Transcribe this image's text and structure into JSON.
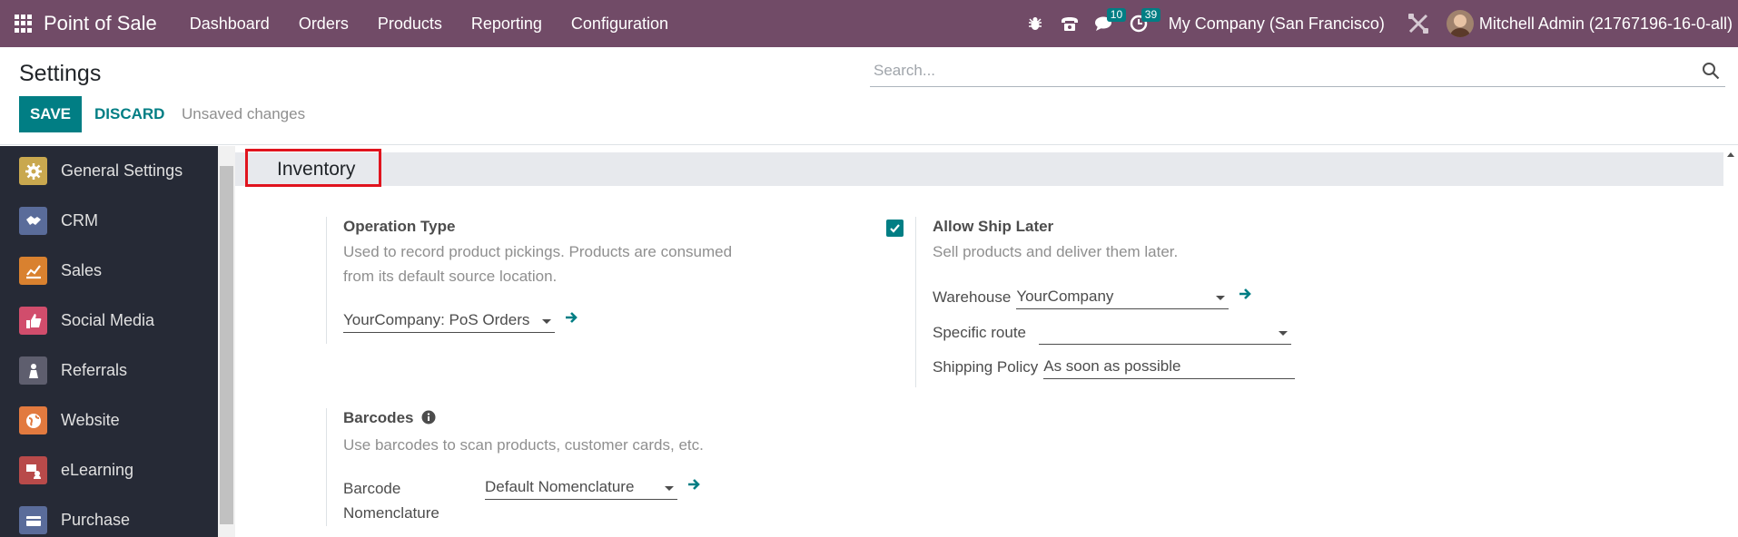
{
  "navbar": {
    "app_name": "Point of Sale",
    "menu": [
      "Dashboard",
      "Orders",
      "Products",
      "Reporting",
      "Configuration"
    ],
    "messages_count": "10",
    "activities_count": "39",
    "company": "My Company (San Francisco)",
    "user": "Mitchell Admin (21767196-16-0-all)"
  },
  "control": {
    "title": "Settings",
    "search_placeholder": "Search...",
    "save_label": "SAVE",
    "discard_label": "DISCARD",
    "status": "Unsaved changes"
  },
  "sidebar": {
    "items": [
      {
        "label": "General Settings",
        "icon": "gear-icon",
        "color": "#c9a84f"
      },
      {
        "label": "CRM",
        "icon": "handshake-icon",
        "color": "#5a6c9a"
      },
      {
        "label": "Sales",
        "icon": "chart-icon",
        "color": "#d9812f"
      },
      {
        "label": "Social Media",
        "icon": "thumbs-up-icon",
        "color": "#d14d6c"
      },
      {
        "label": "Referrals",
        "icon": "referral-icon",
        "color": "#5e5e6e"
      },
      {
        "label": "Website",
        "icon": "globe-icon",
        "color": "#e27a3f"
      },
      {
        "label": "eLearning",
        "icon": "elearning-icon",
        "color": "#b84a4a"
      },
      {
        "label": "Purchase",
        "icon": "purchase-icon",
        "color": "#5a6c9a"
      }
    ]
  },
  "section": {
    "title": "Inventory"
  },
  "operation_type": {
    "title": "Operation Type",
    "description": "Used to record product pickings. Products are consumed from its default source location.",
    "value": "YourCompany: PoS Orders"
  },
  "ship_later": {
    "checked": true,
    "title": "Allow Ship Later",
    "description": "Sell products and deliver them later.",
    "warehouse_label": "Warehouse",
    "warehouse_value": "YourCompany",
    "route_label": "Specific route",
    "route_value": "",
    "policy_label": "Shipping Policy",
    "policy_value": "As soon as possible"
  },
  "barcodes": {
    "title": "Barcodes",
    "description": "Use barcodes to scan products, customer cards, etc.",
    "nomenclature_label": "Barcode Nomenclature",
    "nomenclature_value": "Default Nomenclature"
  },
  "colors": {
    "navbar": "#714b67",
    "primary": "#017e84",
    "highlight": "#e0141e"
  }
}
